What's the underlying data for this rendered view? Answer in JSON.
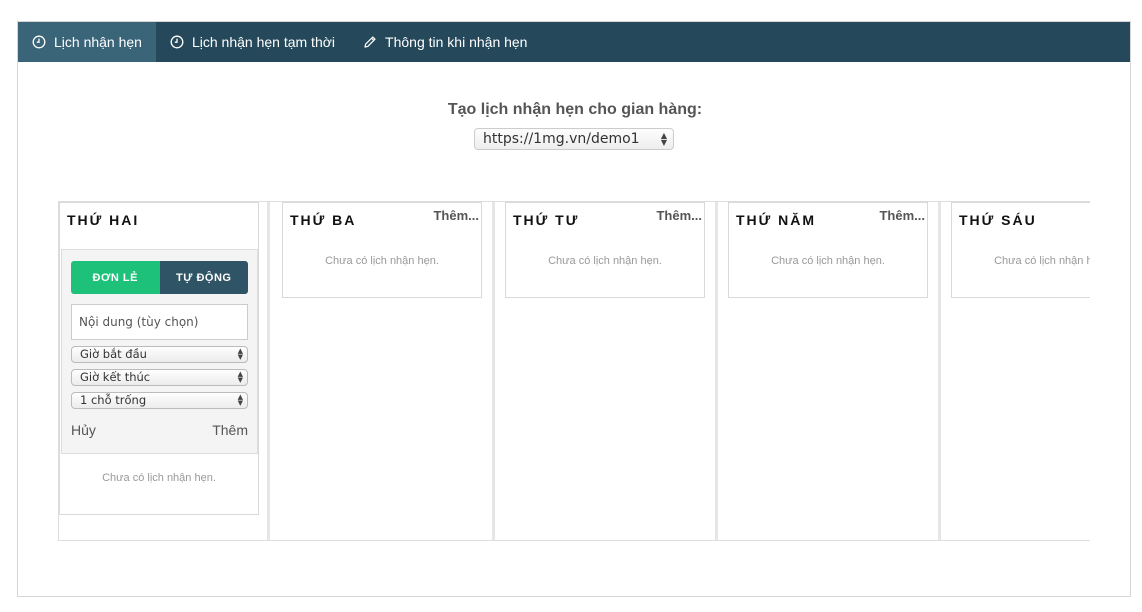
{
  "tabs": [
    {
      "label": "Lịch nhận hẹn",
      "icon": "clock-icon",
      "active": true
    },
    {
      "label": "Lịch nhận hẹn tạm thời",
      "icon": "clock-icon",
      "active": false
    },
    {
      "label": "Thông tin khi nhận hẹn",
      "icon": "pencil-icon",
      "active": false
    }
  ],
  "heading": "Tạo lịch nhận hẹn cho gian hàng:",
  "store_select": {
    "value": "https://1mg.vn/demo1"
  },
  "days": [
    {
      "title": "THỨ HAI",
      "empty": "Chưa có lịch nhận hẹn."
    },
    {
      "title": "THỨ BA",
      "more": "Thêm...",
      "empty": "Chưa có lịch nhận hẹn."
    },
    {
      "title": "THỨ TƯ",
      "more": "Thêm...",
      "empty": "Chưa có lịch nhận hẹn."
    },
    {
      "title": "THỨ NĂM",
      "more": "Thêm...",
      "empty": "Chưa có lịch nhận hẹn."
    },
    {
      "title": "THỨ SÁU",
      "empty": "Chưa có lịch nhận hẹn."
    }
  ],
  "form": {
    "mode_single": "ĐƠN LẺ",
    "mode_auto": "TỰ ĐỘNG",
    "content_placeholder": "Nội dung (tùy chọn)",
    "start_time": "Giờ bắt đầu",
    "end_time": "Giờ kết thúc",
    "slots": "1 chỗ trống",
    "cancel": "Hủy",
    "add": "Thêm"
  },
  "colors": {
    "nav_bg": "#25495a",
    "nav_active": "#3a6478",
    "toggle_on": "#1ec17a",
    "toggle_off": "#2f5466"
  }
}
